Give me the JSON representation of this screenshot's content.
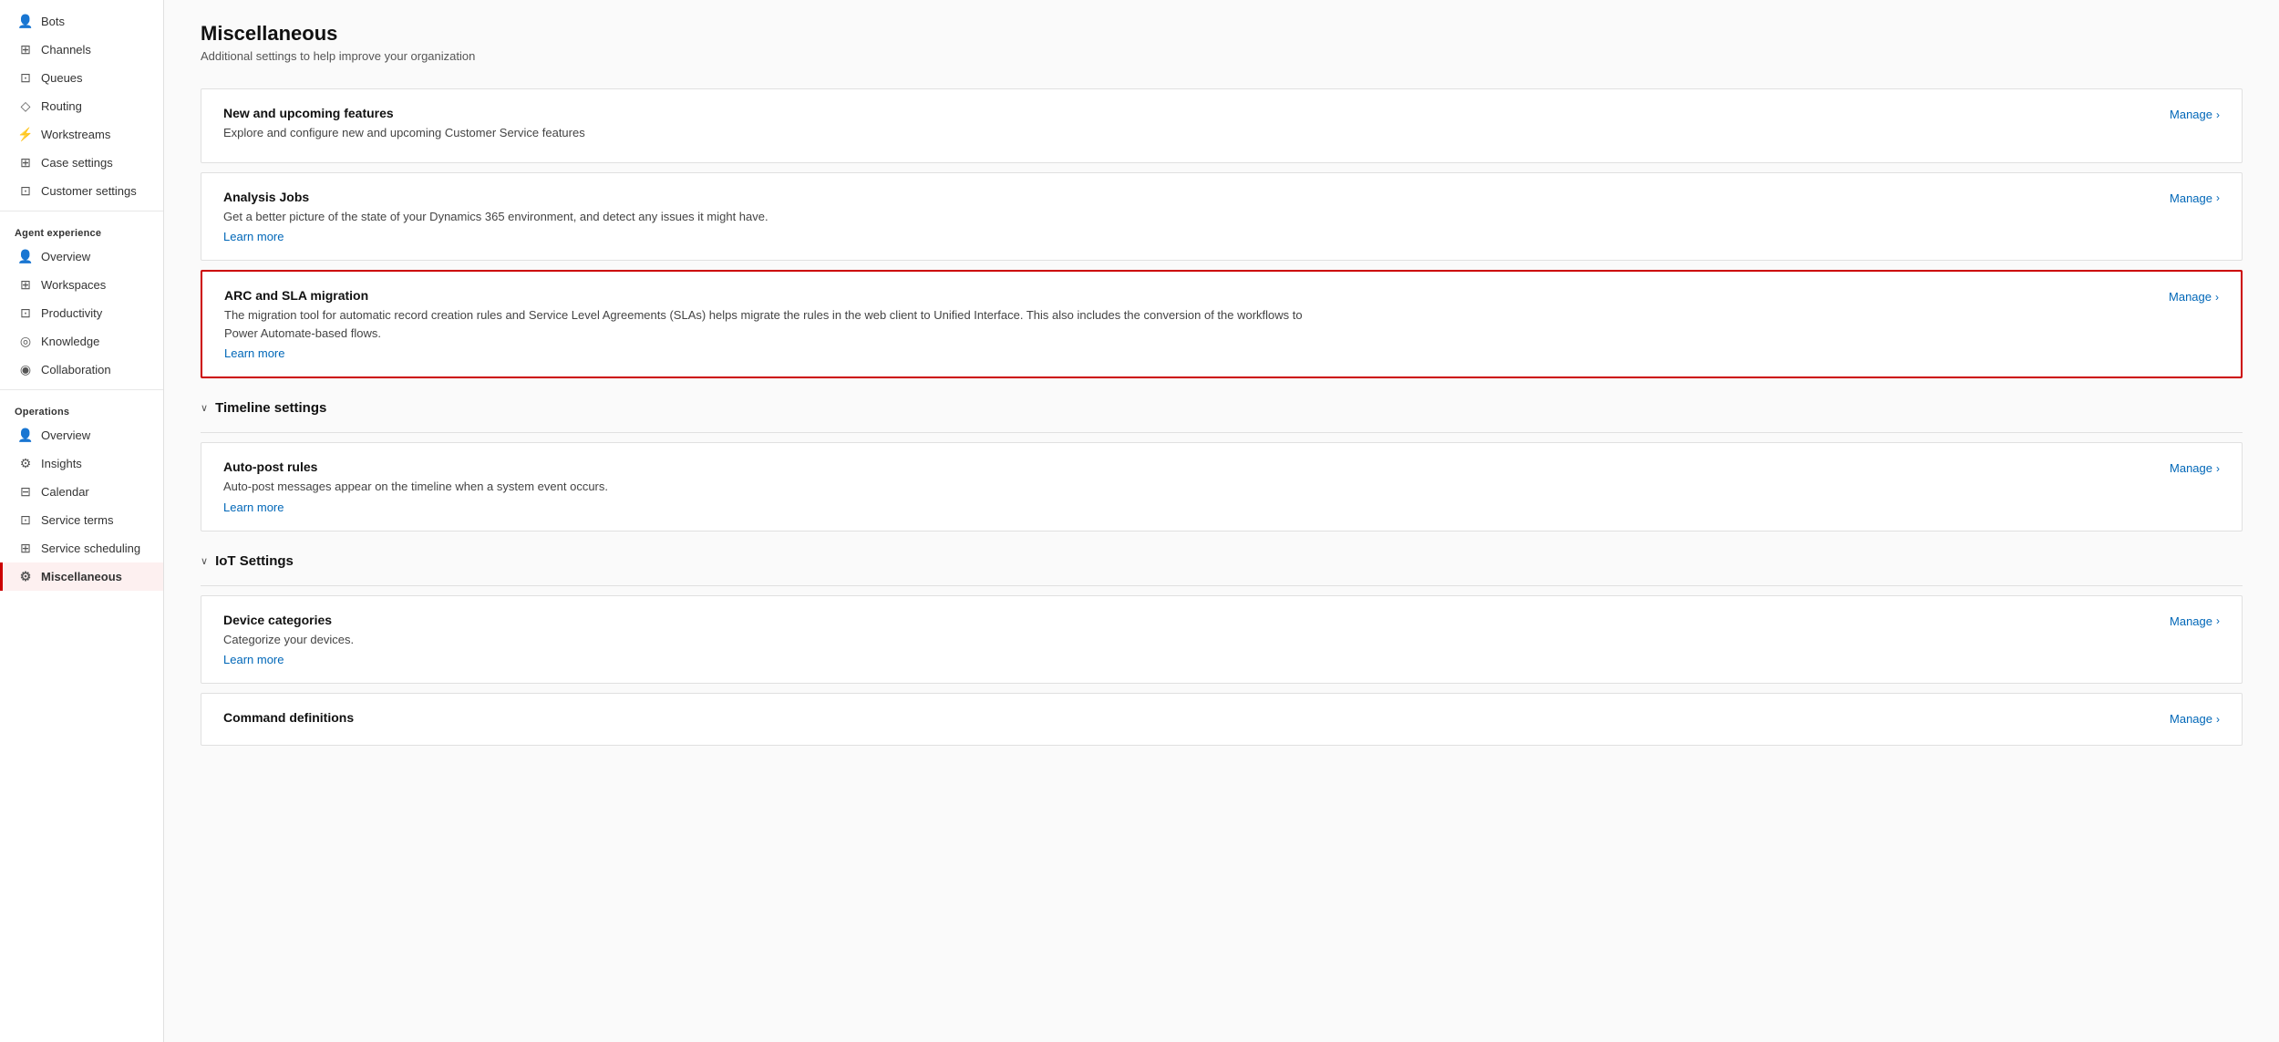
{
  "sidebar": {
    "sections": [
      {
        "name": "",
        "items": [
          {
            "id": "bots",
            "label": "Bots",
            "icon": "👤",
            "active": false
          },
          {
            "id": "channels",
            "label": "Channels",
            "icon": "⊞",
            "active": false
          },
          {
            "id": "queues",
            "label": "Queues",
            "icon": "⊡",
            "active": false
          },
          {
            "id": "routing",
            "label": "Routing",
            "icon": "◇",
            "active": false
          },
          {
            "id": "workstreams",
            "label": "Workstreams",
            "icon": "⚡",
            "active": false
          },
          {
            "id": "case-settings",
            "label": "Case settings",
            "icon": "⊞",
            "active": false
          },
          {
            "id": "customer-settings",
            "label": "Customer settings",
            "icon": "⊡",
            "active": false
          }
        ]
      },
      {
        "name": "Agent experience",
        "items": [
          {
            "id": "ae-overview",
            "label": "Overview",
            "icon": "👤",
            "active": false
          },
          {
            "id": "workspaces",
            "label": "Workspaces",
            "icon": "⊞",
            "active": false
          },
          {
            "id": "productivity",
            "label": "Productivity",
            "icon": "⊡",
            "active": false
          },
          {
            "id": "knowledge",
            "label": "Knowledge",
            "icon": "◎",
            "active": false
          },
          {
            "id": "collaboration",
            "label": "Collaboration",
            "icon": "◉",
            "active": false
          }
        ]
      },
      {
        "name": "Operations",
        "items": [
          {
            "id": "ops-overview",
            "label": "Overview",
            "icon": "👤",
            "active": false
          },
          {
            "id": "insights",
            "label": "Insights",
            "icon": "⚙",
            "active": false
          },
          {
            "id": "calendar",
            "label": "Calendar",
            "icon": "⊟",
            "active": false
          },
          {
            "id": "service-terms",
            "label": "Service terms",
            "icon": "⊡",
            "active": false
          },
          {
            "id": "service-scheduling",
            "label": "Service scheduling",
            "icon": "⊞",
            "active": false
          },
          {
            "id": "miscellaneous",
            "label": "Miscellaneous",
            "icon": "⚙",
            "active": true
          }
        ]
      }
    ]
  },
  "main": {
    "page_title": "Miscellaneous",
    "page_subtitle": "Additional settings to help improve your organization",
    "cards": [
      {
        "id": "new-features",
        "title": "New and upcoming features",
        "desc": "Explore and configure new and upcoming Customer Service features",
        "link": null,
        "manage_label": "Manage",
        "highlighted": false
      },
      {
        "id": "analysis-jobs",
        "title": "Analysis Jobs",
        "desc": "Get a better picture of the state of your Dynamics 365 environment, and detect any issues it might have.",
        "link": "Learn more",
        "manage_label": "Manage",
        "highlighted": false
      },
      {
        "id": "arc-sla",
        "title": "ARC and SLA migration",
        "desc": "The migration tool for automatic record creation rules and Service Level Agreements (SLAs) helps migrate the rules in the web client to Unified Interface. This also includes the conversion of the workflows to Power Automate-based flows.",
        "link": "Learn more",
        "manage_label": "Manage",
        "highlighted": true
      }
    ],
    "timeline_section": {
      "title": "Timeline settings",
      "cards": [
        {
          "id": "auto-post-rules",
          "title": "Auto-post rules",
          "desc": "Auto-post messages appear on the timeline when a system event occurs.",
          "link": "Learn more",
          "manage_label": "Manage"
        }
      ]
    },
    "iot_section": {
      "title": "IoT Settings",
      "cards": [
        {
          "id": "device-categories",
          "title": "Device categories",
          "desc": "Categorize your devices.",
          "link": "Learn more",
          "manage_label": "Manage"
        },
        {
          "id": "command-definitions",
          "title": "Command definitions",
          "desc": "",
          "link": null,
          "manage_label": "Manage"
        }
      ]
    }
  },
  "icons": {
    "chevron_right": "›",
    "chevron_down": "∨"
  }
}
